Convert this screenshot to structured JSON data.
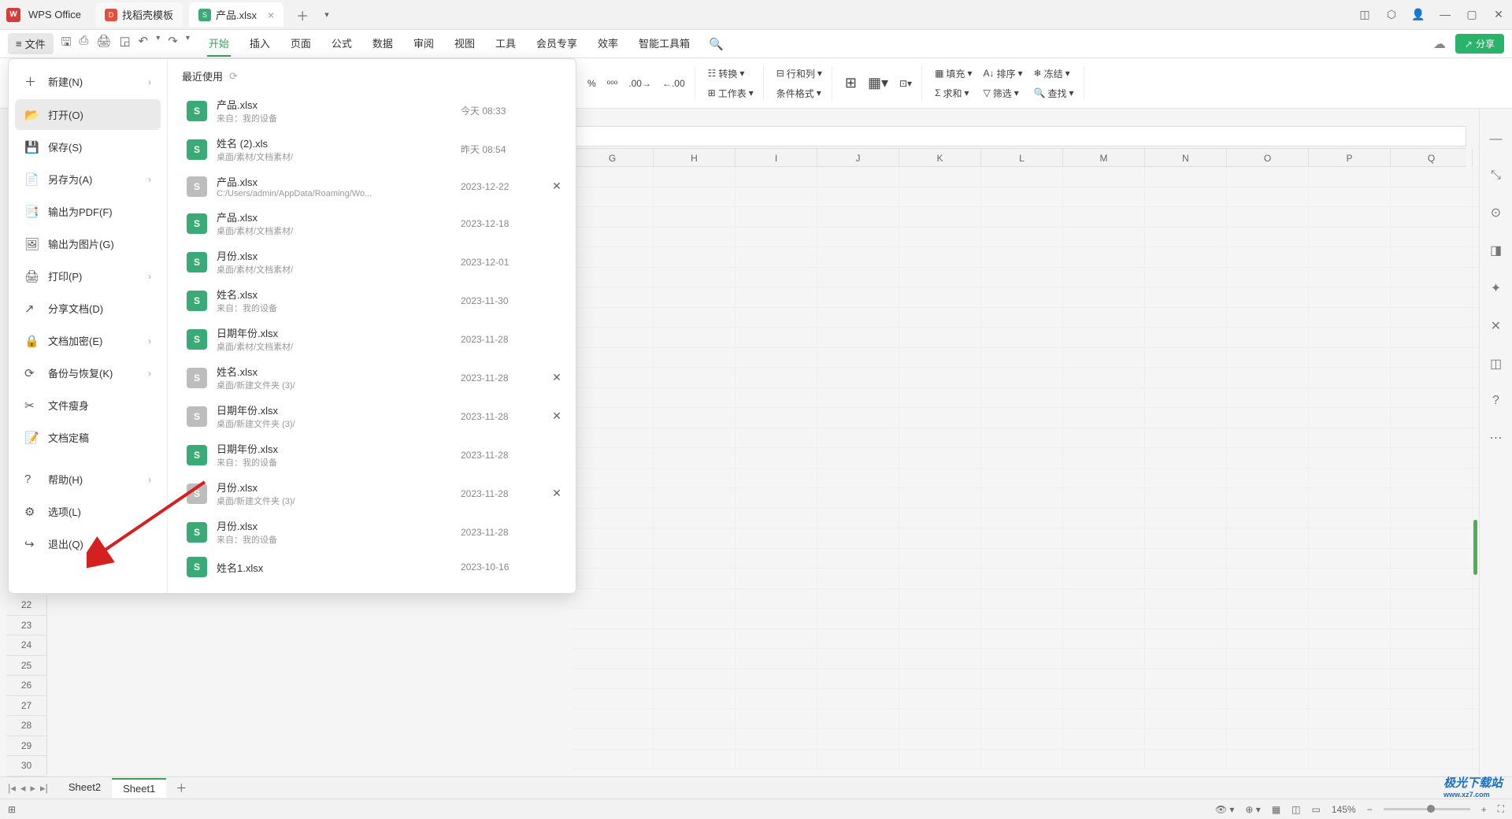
{
  "app": {
    "name": "WPS Office"
  },
  "tabs": [
    {
      "label": "找稻壳模板",
      "iconColor": "#e74c3c"
    },
    {
      "label": "产品.xlsx",
      "iconColor": "#3aaa76",
      "active": true
    }
  ],
  "winControls": {
    "box": "▢",
    "cube": "⬚",
    "user": "👤",
    "min": "—",
    "max": "▭",
    "close": "✕"
  },
  "menubar": {
    "fileLabel": "文件",
    "tabs": [
      "开始",
      "插入",
      "页面",
      "公式",
      "数据",
      "审阅",
      "视图",
      "工具",
      "会员专享",
      "效率",
      "智能工具箱"
    ],
    "activeTab": "开始",
    "share": "分享"
  },
  "ribbon": {
    "convert": "转换",
    "rowcol": "行和列",
    "worksheet": "工作表",
    "condfmt": "条件格式",
    "fill": "填充",
    "sort": "排序",
    "freeze": "冻结",
    "sum": "求和",
    "filter": "筛选",
    "find": "查找"
  },
  "filemenu": {
    "items": [
      {
        "icon": "＋",
        "label": "新建(N)",
        "arrow": true
      },
      {
        "icon": "📂",
        "label": "打开(O)",
        "active": true
      },
      {
        "icon": "💾",
        "label": "保存(S)"
      },
      {
        "icon": "📄",
        "label": "另存为(A)",
        "arrow": true
      },
      {
        "icon": "📑",
        "label": "输出为PDF(F)"
      },
      {
        "icon": "🖼",
        "label": "输出为图片(G)"
      },
      {
        "icon": "🖨",
        "label": "打印(P)",
        "arrow": true
      },
      {
        "icon": "↗",
        "label": "分享文档(D)"
      },
      {
        "icon": "🔒",
        "label": "文档加密(E)",
        "arrow": true
      },
      {
        "icon": "⟳",
        "label": "备份与恢复(K)",
        "arrow": true
      },
      {
        "icon": "✂",
        "label": "文件瘦身"
      },
      {
        "icon": "📝",
        "label": "文档定稿"
      },
      {
        "icon": "?",
        "label": "帮助(H)",
        "arrow": true
      },
      {
        "icon": "⚙",
        "label": "选项(L)"
      },
      {
        "icon": "↪",
        "label": "退出(Q)"
      }
    ],
    "recentHeader": "最近使用",
    "recent": [
      {
        "name": "产品.xlsx",
        "path": "来自：我的设备",
        "date": "今天  08:33",
        "cls": "cloud"
      },
      {
        "name": "姓名 (2).xls",
        "path": "桌面/素材/文档素材/",
        "date": "昨天  08:54",
        "cls": "green"
      },
      {
        "name": "产品.xlsx",
        "path": "C:/Users/admin/AppData/Roaming/Wo...",
        "date": "2023-12-22",
        "cls": "gray",
        "close": true
      },
      {
        "name": "产品.xlsx",
        "path": "桌面/素材/文档素材/",
        "date": "2023-12-18",
        "cls": "green"
      },
      {
        "name": "月份.xlsx",
        "path": "桌面/素材/文档素材/",
        "date": "2023-12-01",
        "cls": "green"
      },
      {
        "name": "姓名.xlsx",
        "path": "来自：我的设备",
        "date": "2023-11-30",
        "cls": "cloud"
      },
      {
        "name": "日期年份.xlsx",
        "path": "桌面/素材/文档素材/",
        "date": "2023-11-28",
        "cls": "green"
      },
      {
        "name": "姓名.xlsx",
        "path": "桌面/新建文件夹 (3)/",
        "date": "2023-11-28",
        "cls": "gray",
        "close": true
      },
      {
        "name": "日期年份.xlsx",
        "path": "桌面/新建文件夹 (3)/",
        "date": "2023-11-28",
        "cls": "gray",
        "close": true
      },
      {
        "name": "日期年份.xlsx",
        "path": "来自：我的设备",
        "date": "2023-11-28",
        "cls": "cloud"
      },
      {
        "name": "月份.xlsx",
        "path": "桌面/新建文件夹 (3)/",
        "date": "2023-11-28",
        "cls": "gray",
        "close": true
      },
      {
        "name": "月份.xlsx",
        "path": "来自：我的设备",
        "date": "2023-11-28",
        "cls": "cloud"
      },
      {
        "name": "姓名1.xlsx",
        "path": "",
        "date": "2023-10-16",
        "cls": "green"
      }
    ]
  },
  "columns": [
    "G",
    "H",
    "I",
    "J",
    "K",
    "L",
    "M",
    "N",
    "O",
    "P",
    "Q"
  ],
  "rows": [
    22,
    23,
    24,
    25,
    26,
    27,
    28,
    29,
    30
  ],
  "sheets": {
    "list": [
      "Sheet2",
      "Sheet1"
    ],
    "active": "Sheet1"
  },
  "status": {
    "zoom": "145%"
  },
  "watermark": {
    "t1": "极光下载站",
    "t2": "www.xz7.com"
  }
}
